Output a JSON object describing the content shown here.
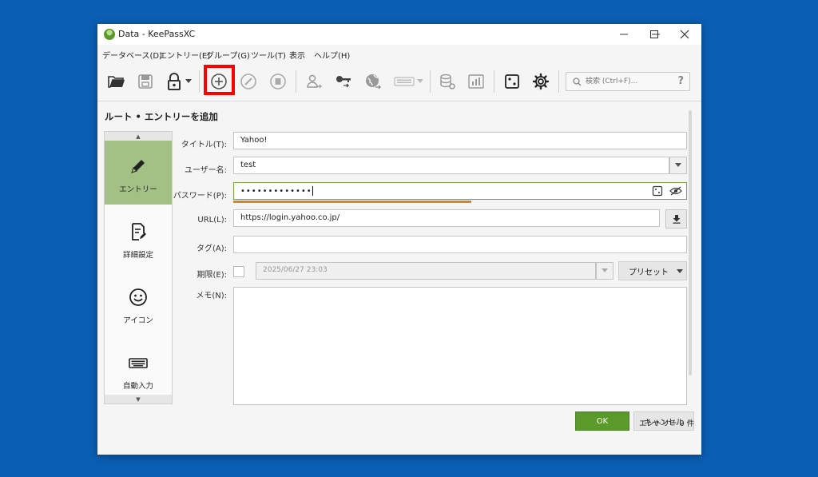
{
  "window": {
    "title": "Data - KeePassXC",
    "controls": {
      "minimize": "—",
      "maximize": "☐",
      "close": "✕"
    }
  },
  "menu": [
    "データベース(D)",
    "エントリー(E)",
    "グループ(G)",
    "ツール(T)",
    "表示",
    "ヘルプ(H)"
  ],
  "toolbar": {
    "icons": [
      "open-database-icon",
      "save-database-icon",
      "lock-database-icon",
      "add-entry-icon",
      "edit-entry-icon",
      "delete-entry-icon",
      "copy-username-icon",
      "copy-password-icon",
      "open-url-icon",
      "autotype-icon",
      "database-settings-icon",
      "reports-icon",
      "password-generator-icon",
      "settings-icon"
    ],
    "search_placeholder": "検索 (Ctrl+F)...",
    "help": "?"
  },
  "page_title": "ルート • エントリーを追加",
  "side_panel": {
    "items": [
      {
        "label": "エントリー",
        "icon": "pencil-icon",
        "active": true
      },
      {
        "label": "詳細設定",
        "icon": "document-edit-icon",
        "active": false
      },
      {
        "label": "アイコン",
        "icon": "smiley-icon",
        "active": false
      },
      {
        "label": "自動入力",
        "icon": "keyboard-icon",
        "active": false
      }
    ],
    "scroll_up": "▲",
    "scroll_down": "▼"
  },
  "form": {
    "title": {
      "label": "タイトル(T):",
      "value": "Yahoo!"
    },
    "username": {
      "label": "ユーザー名:",
      "value": "test"
    },
    "password": {
      "label": "パスワード(P):",
      "value": "•••••••••••••",
      "strength": 0.5
    },
    "url": {
      "label": "URL(L):",
      "value": "https://login.yahoo.co.jp/"
    },
    "tags": {
      "label": "タグ(A):",
      "value": ""
    },
    "expiry": {
      "label": "期限(E):",
      "value": "2025/06/27 23:03",
      "preset": "プリセット"
    },
    "notes": {
      "label": "メモ(N):",
      "value": ""
    }
  },
  "buttons": {
    "ok": "OK",
    "cancel": "キャンセル"
  },
  "status": "エントリー 0 件",
  "colors": {
    "desktop": "#0a5fb4",
    "accent_green": "#5a9a2a",
    "active_side": "#a3c185",
    "strength_bar": "#d18a1e",
    "highlight": "#ff0000"
  }
}
